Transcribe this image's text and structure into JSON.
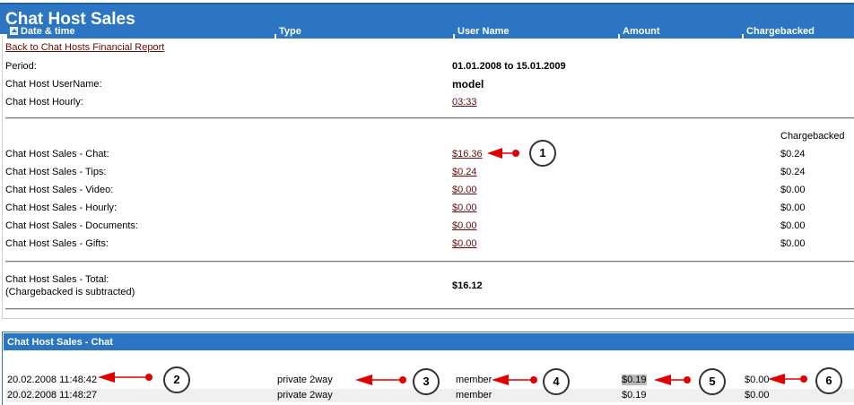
{
  "page_title": "Chat Host Sales",
  "back_link": "Back to Chat Hosts Financial Report",
  "info": {
    "period_label": "Period:",
    "period_value": "01.01.2008 to 15.01.2009",
    "username_label": "Chat Host UserName:",
    "username_value": "model",
    "hourly_label": "Chat Host Hourly:",
    "hourly_value": "03:33"
  },
  "sales": {
    "chargebacked_header": "Chargebacked",
    "rows": [
      {
        "label": "Chat Host Sales - Chat:",
        "value": "$16.36",
        "chargebacked": "$0.24"
      },
      {
        "label": "Chat Host Sales - Tips:",
        "value": "$0.24",
        "chargebacked": "$0.24"
      },
      {
        "label": "Chat Host Sales - Video:",
        "value": "$0.00",
        "chargebacked": "$0.00"
      },
      {
        "label": "Chat Host Sales - Hourly:",
        "value": "$0.00",
        "chargebacked": "$0.00"
      },
      {
        "label": "Chat Host Sales - Documents:",
        "value": "$0.00",
        "chargebacked": "$0.00"
      },
      {
        "label": "Chat Host Sales - Gifts:",
        "value": "$0.00",
        "chargebacked": "$0.00"
      }
    ],
    "total_label_line1": "Chat Host Sales - Total:",
    "total_label_line2": "(Chargebacked is subtracted)",
    "total_value": "$16.12"
  },
  "chat_table": {
    "title": "Chat Host Sales - Chat",
    "columns": [
      "Date & time",
      "Type",
      "User Name",
      "Amount",
      "Chargebacked"
    ],
    "rows": [
      [
        "20.02.2008 11:48:42",
        "private 2way",
        "member",
        "$0.19",
        "$0.00"
      ],
      [
        "20.02.2008 11:48:27",
        "private 2way",
        "member",
        "$0.19",
        "$0.00"
      ]
    ]
  },
  "callouts": [
    "1",
    "2",
    "3",
    "4",
    "5",
    "6"
  ],
  "colors": {
    "header_blue": "#2b75c2",
    "link": "#6b0a0a",
    "arrow_red": "#e00000",
    "row_alt": "#efefef",
    "amount_highlight": "#b9b9b9"
  }
}
